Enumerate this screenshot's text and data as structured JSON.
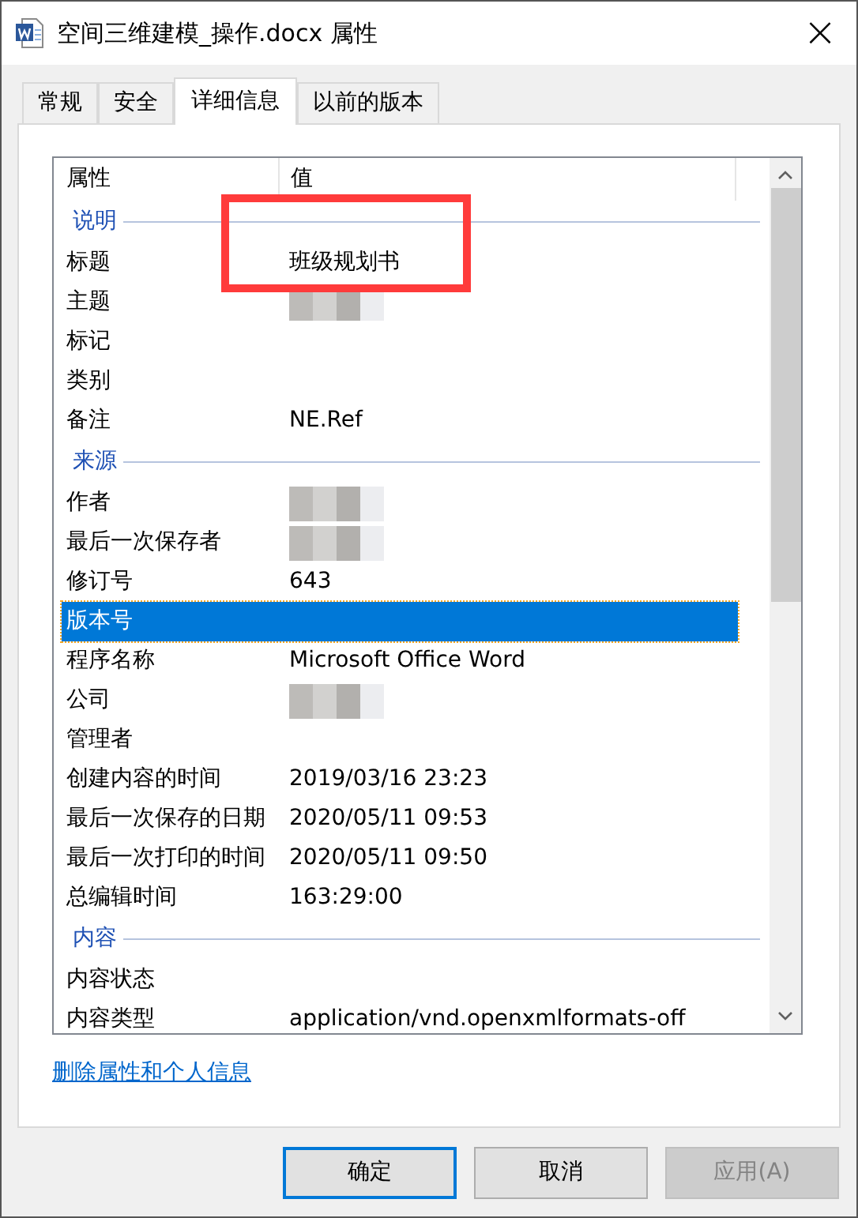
{
  "window": {
    "title": "空间三维建模_操作.docx 属性",
    "close": "×"
  },
  "tabs": [
    {
      "label": "常规",
      "selected": false
    },
    {
      "label": "安全",
      "selected": false
    },
    {
      "label": "详细信息",
      "selected": true
    },
    {
      "label": "以前的版本",
      "selected": false
    }
  ],
  "table": {
    "columns": [
      "属性",
      "值"
    ],
    "rows": [
      {
        "kind": "section",
        "label": "说明"
      },
      {
        "kind": "row",
        "property": "标题",
        "value": "班级规划书",
        "selected": false,
        "annotated": true
      },
      {
        "kind": "redacted",
        "property": "主题",
        "selected": false
      },
      {
        "kind": "row",
        "property": "标记",
        "value": "",
        "selected": false
      },
      {
        "kind": "row",
        "property": "类别",
        "value": "",
        "selected": false
      },
      {
        "kind": "row",
        "property": "备注",
        "value": "NE.Ref",
        "selected": false
      },
      {
        "kind": "section",
        "label": "来源"
      },
      {
        "kind": "redacted",
        "property": "作者",
        "selected": false
      },
      {
        "kind": "redacted",
        "property": "最后一次保存者",
        "selected": false
      },
      {
        "kind": "row",
        "property": "修订号",
        "value": "643",
        "selected": false
      },
      {
        "kind": "row",
        "property": "版本号",
        "value": "",
        "selected": true
      },
      {
        "kind": "row",
        "property": "程序名称",
        "value": "Microsoft Office Word",
        "selected": false
      },
      {
        "kind": "redacted",
        "property": "公司",
        "selected": false
      },
      {
        "kind": "row",
        "property": "管理者",
        "value": "",
        "selected": false
      },
      {
        "kind": "row",
        "property": "创建内容的时间",
        "value": "2019/03/16 23:23",
        "selected": false
      },
      {
        "kind": "row",
        "property": "最后一次保存的日期",
        "value": "2020/05/11 09:53",
        "selected": false
      },
      {
        "kind": "row",
        "property": "最后一次打印的时间",
        "value": "2020/05/11 09:50",
        "selected": false
      },
      {
        "kind": "row",
        "property": "总编辑时间",
        "value": "163:29:00",
        "selected": false
      },
      {
        "kind": "section",
        "label": "内容"
      },
      {
        "kind": "row",
        "property": "内容状态",
        "value": "",
        "selected": false
      },
      {
        "kind": "row",
        "property": "内容类型",
        "value": "application/vnd.openxmlformats-off",
        "selected": false
      }
    ]
  },
  "link": "删除属性和个人信息",
  "buttons": [
    {
      "label": "确定",
      "default": true,
      "disabled": false
    },
    {
      "label": "取消",
      "default": false,
      "disabled": false
    },
    {
      "label": "应用(A)",
      "default": false,
      "disabled": true
    }
  ]
}
